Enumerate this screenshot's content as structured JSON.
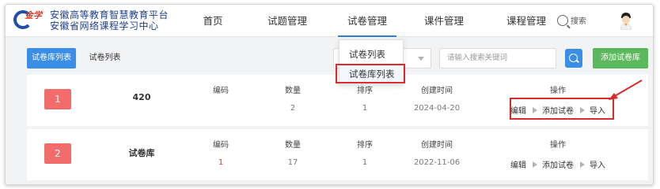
{
  "header": {
    "logo_word": "金学",
    "logo_line1": "安徽高等教育智慧教育平台",
    "logo_line2": "安徽省网络课程学习中心",
    "nav": [
      "首页",
      "试题管理",
      "试卷管理",
      "课件管理",
      "课程管理"
    ],
    "active_nav": "试卷管理",
    "search_label": "搜索"
  },
  "dropdown": {
    "items": [
      "试卷列表",
      "试卷库列表"
    ],
    "highlighted": "试卷库列表"
  },
  "toolbar": {
    "tab_library": "试卷库列表",
    "tab_list": "试卷列表",
    "search_placeholder": "请输入搜索关键词",
    "add_button": "添加试卷库"
  },
  "table": {
    "columns": [
      "编码",
      "数量",
      "排序",
      "创建时间",
      "操作"
    ],
    "rows": [
      {
        "index": "1",
        "name": "420",
        "code": "",
        "count": "2",
        "order": "1",
        "created": "2024-04-20",
        "ops": [
          "编辑",
          "添加试卷",
          "导入"
        ]
      },
      {
        "index": "2",
        "name": "试卷库",
        "code": "1",
        "count": "17",
        "order": "1",
        "created": "2022-11-06",
        "ops": [
          "编辑",
          "添加试卷",
          "导入"
        ]
      }
    ]
  },
  "colors": {
    "primary": "#3a8ee6",
    "success": "#5cb85c",
    "badge": "#f36c6c",
    "annotation": "#d92b2b"
  }
}
